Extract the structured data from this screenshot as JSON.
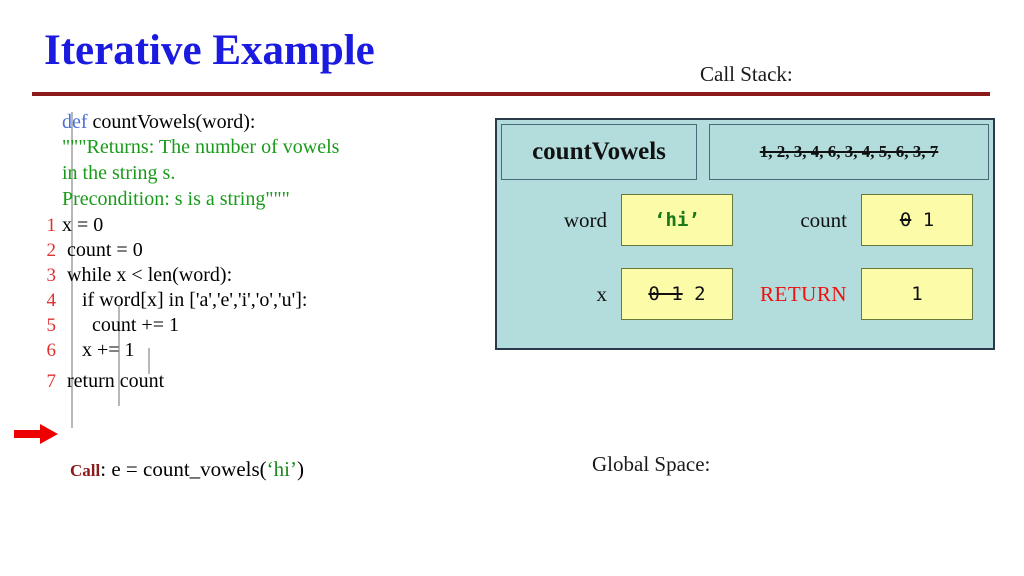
{
  "slide": {
    "title": "Iterative Example",
    "title_color": "#1a1ae0",
    "rule_color": "#8b1a1a"
  },
  "headers": {
    "call_stack": "Call Stack:",
    "global_space": "Global Space:"
  },
  "code": {
    "signature": {
      "keyword": "def",
      "rest": " countVowels(word):"
    },
    "docstring": [
      "\"\"\"Returns: The number of vowels",
      "in the string s.",
      "Precondition: s is a string\"\"\""
    ],
    "lines": [
      {
        "num": "1",
        "text": "x = 0"
      },
      {
        "num": "2",
        "text": " count = 0"
      },
      {
        "num": "3",
        "text": " while x < len(word):"
      },
      {
        "num": "4",
        "text": "    if word[x] in ['a','e','i','o','u']:"
      },
      {
        "num": "5",
        "text": "      count += 1"
      },
      {
        "num": "6",
        "text": "    x += 1"
      },
      {
        "num": "7",
        "text": " return count"
      }
    ],
    "current_line": "7",
    "line_number_color": "#e03030",
    "docstring_color": "#1a9a1a",
    "keyword_color": "#4a6fd0"
  },
  "call": {
    "label": "Call",
    "separator": ": ",
    "expression_pre": "e = count_vowels(",
    "argument": "‘hi’",
    "expression_post": ")",
    "label_color": "#8b1a1a",
    "argument_color": "#1a8a1a"
  },
  "call_stack": {
    "frame": {
      "name": "countVowels",
      "trace": "1, 2, 3, 4, 6, 3, 4, 5, 6, 3, 7",
      "trace_struck": true,
      "background": "#b3dcdc",
      "border": "#2b3a4a",
      "variables": [
        {
          "name": "word",
          "old_values": "",
          "current_value": "‘hi’",
          "is_string": true
        },
        {
          "name": "count",
          "old_values": "0",
          "current_value": "1",
          "is_string": false
        },
        {
          "name": "x",
          "old_values": "0 1",
          "current_value": "2",
          "is_string": false
        },
        {
          "name": "RETURN",
          "old_values": "",
          "current_value": "1",
          "is_string": false,
          "is_return": true
        }
      ],
      "value_box_color": "#fbfba8",
      "return_label_color": "#ee1111"
    }
  },
  "arrow": {
    "color": "#ee0000",
    "points_to_line": "7"
  }
}
